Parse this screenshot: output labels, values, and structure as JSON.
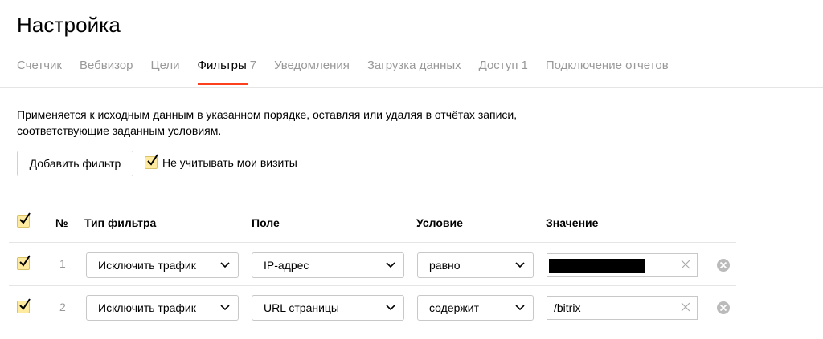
{
  "page_title": "Настройка",
  "tabs": [
    {
      "label": "Счетчик",
      "count": ""
    },
    {
      "label": "Вебвизор",
      "count": ""
    },
    {
      "label": "Цели",
      "count": ""
    },
    {
      "label": "Фильтры",
      "count": "7"
    },
    {
      "label": "Уведомления",
      "count": ""
    },
    {
      "label": "Загрузка данных",
      "count": ""
    },
    {
      "label": "Доступ",
      "count": "1"
    },
    {
      "label": "Подключение отчетов",
      "count": ""
    }
  ],
  "active_tab": "Фильтры",
  "description": "Применяется к исходным данным в указанном порядке, оставляя или удаляя в отчётах записи, соответствующие заданным условиям.",
  "add_filter_label": "Добавить фильтр",
  "ignore_visits_label": "Не учитывать мои визиты",
  "table": {
    "headers": {
      "num": "№",
      "filter_type": "Тип фильтра",
      "field": "Поле",
      "condition": "Условие",
      "value": "Значение"
    },
    "rows": [
      {
        "num": "1",
        "filter_type": "Исключить трафик",
        "field": "IP-адрес",
        "condition": "равно",
        "value": "",
        "checked": true
      },
      {
        "num": "2",
        "filter_type": "Исключить трафик",
        "field": "URL страницы",
        "condition": "содержит",
        "value": "/bitrix",
        "checked": true
      }
    ]
  },
  "colors": {
    "accent": "#fc3f1d",
    "checkbox_fill": "#ffeba0",
    "muted_text": "#999999"
  }
}
